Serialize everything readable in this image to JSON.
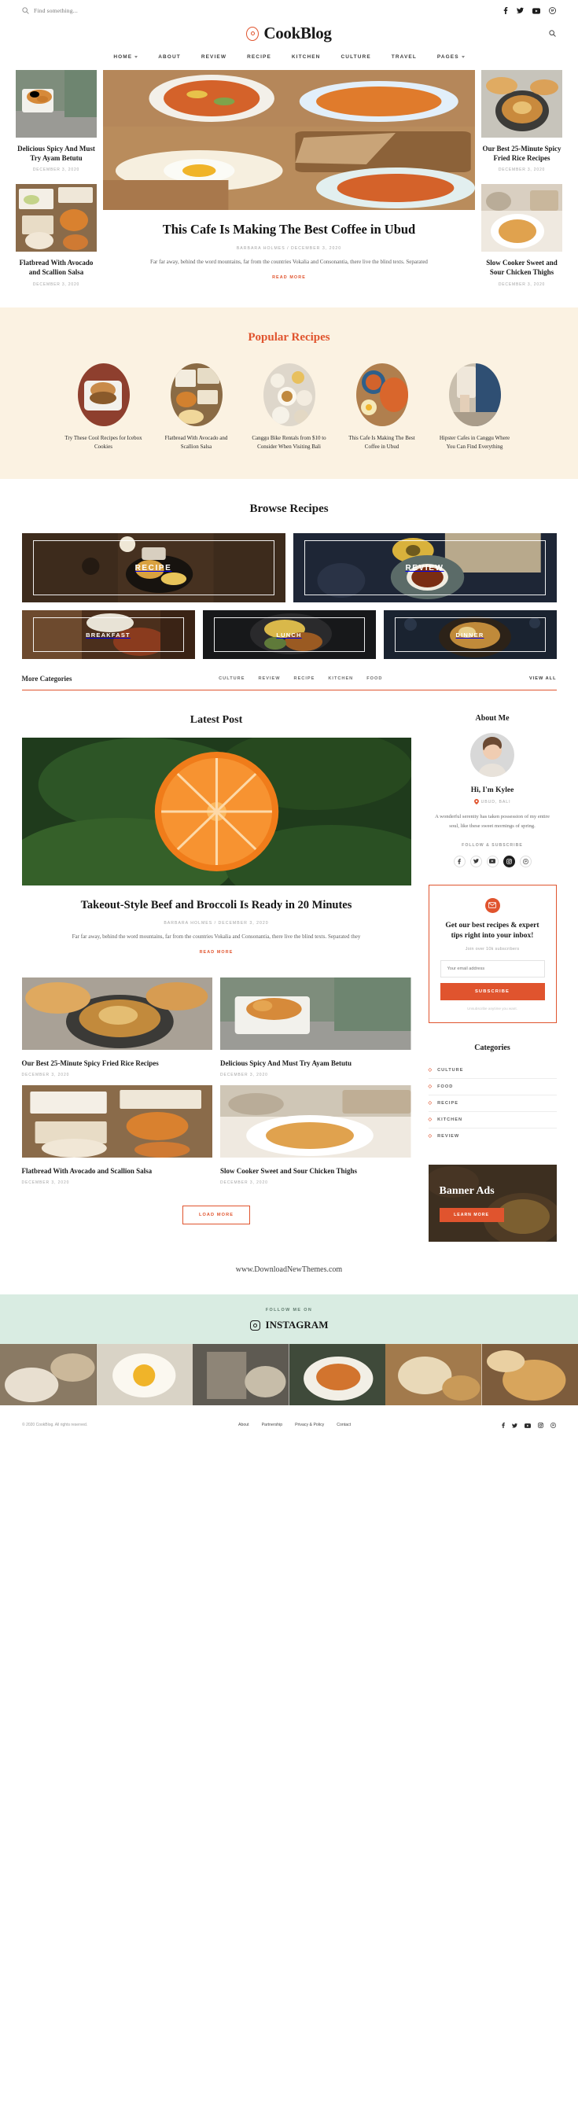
{
  "topbar": {
    "search_placeholder": "Find something...",
    "search_value": "",
    "search_icon": "search-icon",
    "socials": [
      {
        "name": "facebook-icon",
        "glyph": "f"
      },
      {
        "name": "twitter-icon",
        "glyph": "t"
      },
      {
        "name": "youtube-icon",
        "glyph": "y"
      },
      {
        "name": "pinterest-icon",
        "glyph": "p"
      }
    ]
  },
  "brand": {
    "name": "CookBlog",
    "mark": "target-circle-logo",
    "search_icon": "search-icon"
  },
  "nav": [
    {
      "label": "HOME",
      "caret": true
    },
    {
      "label": "ABOUT",
      "caret": false
    },
    {
      "label": "REVIEW",
      "caret": false
    },
    {
      "label": "RECIPE",
      "caret": false
    },
    {
      "label": "KITCHEN",
      "caret": false
    },
    {
      "label": "CULTURE",
      "caret": false
    },
    {
      "label": "TRAVEL",
      "caret": false
    },
    {
      "label": "PAGES",
      "caret": true
    }
  ],
  "hero": {
    "left": [
      {
        "title": "Delicious Spicy And Must Try Ayam Betutu",
        "date": "DECEMBER 3, 2020"
      },
      {
        "title": "Flatbread With Avocado and Scallion Salsa",
        "date": "DECEMBER 3, 2020"
      }
    ],
    "right": [
      {
        "title": "Our Best 25-Minute Spicy Fried Rice Recipes",
        "date": "DECEMBER 3, 2020"
      },
      {
        "title": "Slow Cooker Sweet and Sour Chicken Thighs",
        "date": "DECEMBER 3, 2020"
      }
    ],
    "feature": {
      "title": "This Cafe Is Making The Best Coffee in Ubud",
      "meta": "BARBARA HOLMES / DECEMBER 3, 2020",
      "excerpt": "Far far away, behind the word mountains, far from the countries Vokalia and Consonantia, there live the blind texts. Separated",
      "read_more": "READ MORE"
    }
  },
  "popular": {
    "title": "Popular Recipes",
    "items": [
      {
        "title": "Try These Cool Recipes for Icebox Cookies"
      },
      {
        "title": "Flatbread With Avocado and Scallion Salsa"
      },
      {
        "title": "Canggu Bike Rentals from $10 to Consider When Visiting Bali"
      },
      {
        "title": "This Cafe Is Making The Best Coffee in Ubud"
      },
      {
        "title": "Hipster Cafes in Canggu Where You Can Find Everything"
      }
    ]
  },
  "browse": {
    "title": "Browse Recipes",
    "big_tiles": [
      {
        "label": "RECIPE"
      },
      {
        "label": "REVIEW"
      }
    ],
    "small_tiles": [
      {
        "label": "BREAKFAST"
      },
      {
        "label": "LUNCH"
      },
      {
        "label": "DINNER"
      }
    ],
    "more_title": "More Categories",
    "more_links": [
      "CULTURE",
      "REVIEW",
      "RECIPE",
      "KITCHEN",
      "FOOD"
    ],
    "view_all": "VIEW ALL"
  },
  "latest": {
    "title": "Latest Post",
    "feature": {
      "title": "Takeout-Style Beef and Broccoli Is Ready in 20 Minutes",
      "meta": "BARBARA HOLMES / DECEMBER 3, 2020",
      "excerpt": "Far far away, behind the word mountains, far from the countries Vokalia and Consonantia, there live the blind texts. Separated they",
      "read_more": "READ MORE"
    },
    "posts": [
      {
        "title": "Our Best 25-Minute Spicy Fried Rice Recipes",
        "date": "DECEMBER 3, 2020"
      },
      {
        "title": "Delicious Spicy And Must Try Ayam Betutu",
        "date": "DECEMBER 3, 2020"
      },
      {
        "title": "Flatbread With Avocado and Scallion Salsa",
        "date": "DECEMBER 3, 2020"
      },
      {
        "title": "Slow Cooker Sweet and Sour Chicken Thighs",
        "date": "DECEMBER 3, 2020"
      }
    ],
    "load_more": "LOAD MORE"
  },
  "sidebar": {
    "about": {
      "title": "About Me",
      "avatar": "author-avatar",
      "name": "Hi, I'm Kylee",
      "location": "UBUD, BALI",
      "location_icon": "map-pin-icon",
      "bio": "A wonderful serenity has taken possession of my entire soul, like these sweet mornings of spring.",
      "follow_label": "FOLLOW & SUBSCRIBE",
      "socials": [
        {
          "name": "facebook-icon",
          "glyph": "f"
        },
        {
          "name": "twitter-icon",
          "glyph": "t"
        },
        {
          "name": "youtube-icon",
          "glyph": "y"
        },
        {
          "name": "instagram-icon",
          "glyph": "i"
        },
        {
          "name": "pinterest-icon",
          "glyph": "p"
        }
      ]
    },
    "newsletter": {
      "icon": "envelope-icon",
      "heading": "Get our best recipes & expert tips right into your inbox!",
      "subheading": "Join over 10k subscribers",
      "email_placeholder": "Your email address",
      "email_value": "",
      "button": "SUBSCRIBE",
      "note": "Unsubscribe anytime you want."
    },
    "categories": {
      "title": "Categories",
      "items": [
        "CULTURE",
        "FOOD",
        "RECIPE",
        "KITCHEN",
        "REVIEW"
      ]
    },
    "banner": {
      "title": "Banner Ads",
      "button": "LEARN MORE"
    }
  },
  "promo": {
    "text": "www.DownloadNewThemes.com"
  },
  "instagram": {
    "follow_label": "FOLLOW ME ON",
    "title": "INSTAGRAM",
    "icon": "instagram-icon",
    "tiles": 6
  },
  "footer": {
    "copyright": "© 2020 CookBlog. All rights reserved.",
    "links": [
      "About",
      "Partnership",
      "Privacy & Policy",
      "Contact"
    ],
    "socials": [
      {
        "name": "facebook-icon",
        "glyph": "f"
      },
      {
        "name": "twitter-icon",
        "glyph": "t"
      },
      {
        "name": "youtube-icon",
        "glyph": "y"
      },
      {
        "name": "instagram-icon",
        "glyph": "i"
      },
      {
        "name": "pinterest-icon",
        "glyph": "p"
      }
    ]
  },
  "colors": {
    "accent": "#e0542e",
    "cream": "#fbf2e2",
    "mint": "#d9ece2",
    "ink": "#1a1a1a",
    "muted": "#a3a3a3"
  }
}
